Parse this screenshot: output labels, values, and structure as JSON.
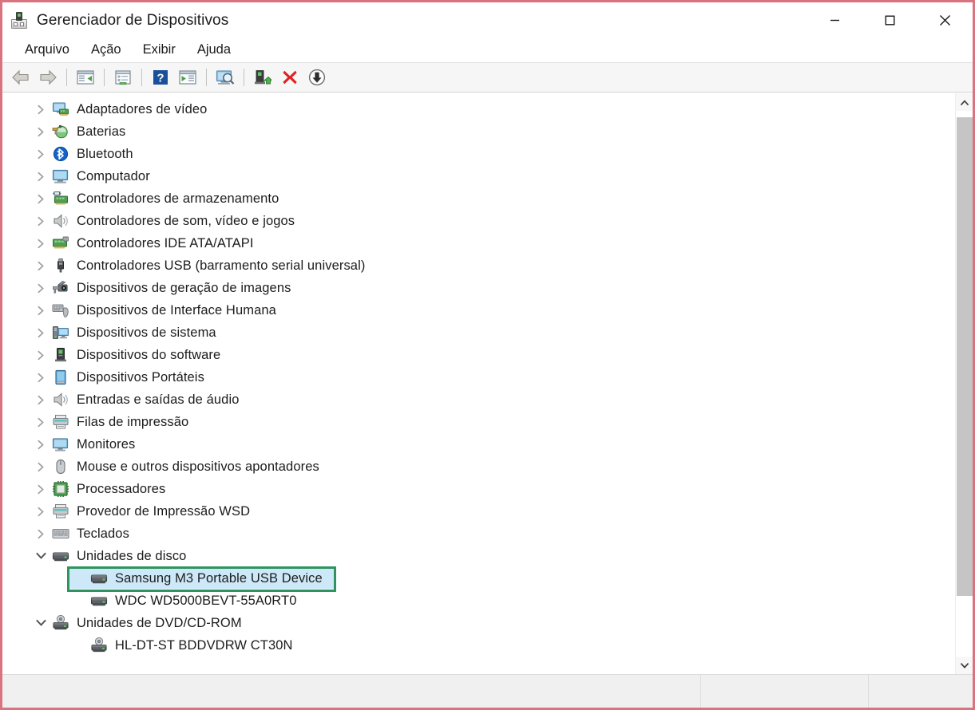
{
  "window": {
    "title": "Gerenciador de Dispositivos",
    "icon": "device-manager-icon",
    "controls": {
      "minimize": "minimize-icon",
      "maximize": "maximize-icon",
      "close": "close-icon"
    }
  },
  "annotation": {
    "frame_color": "#d9737f",
    "device_box_color": "#2f9460"
  },
  "menu": {
    "items": [
      {
        "label": "Arquivo",
        "name": "menu-arquivo"
      },
      {
        "label": "Ação",
        "name": "menu-acao"
      },
      {
        "label": "Exibir",
        "name": "menu-exibir"
      },
      {
        "label": "Ajuda",
        "name": "menu-ajuda"
      }
    ]
  },
  "toolbar": {
    "buttons": [
      {
        "icon": "back-arrow-icon",
        "tooltip": "Voltar"
      },
      {
        "icon": "forward-arrow-icon",
        "tooltip": "Avançar"
      },
      {
        "icon": "show-hide-console-tree-icon",
        "tooltip": "Mostrar/Ocultar árvore do console"
      },
      {
        "icon": "properties-icon",
        "tooltip": "Propriedades"
      },
      {
        "icon": "help-icon",
        "tooltip": "Ajuda"
      },
      {
        "icon": "show-hide-action-pane-icon",
        "tooltip": "Mostrar/Ocultar painel de ações"
      },
      {
        "icon": "scan-for-hardware-changes-icon",
        "tooltip": "Verificar se há alterações de hardware"
      },
      {
        "icon": "update-driver-icon",
        "tooltip": "Atualizar driver"
      },
      {
        "icon": "disable-device-icon",
        "tooltip": "Desabilitar dispositivo"
      },
      {
        "icon": "install-legacy-hardware-icon",
        "tooltip": "Instalar hardware"
      }
    ]
  },
  "tree": {
    "selection": {
      "bg_color": "#cde8f8"
    },
    "nodes": [
      {
        "label": "Adaptadores de vídeo",
        "icon": "display-adapter-icon",
        "depth": 1,
        "state": "collapsed",
        "selected": false
      },
      {
        "label": "Baterias",
        "icon": "battery-icon",
        "depth": 1,
        "state": "collapsed",
        "selected": false
      },
      {
        "label": "Bluetooth",
        "icon": "bluetooth-icon",
        "depth": 1,
        "state": "collapsed",
        "selected": false
      },
      {
        "label": "Computador",
        "icon": "computer-icon",
        "depth": 1,
        "state": "collapsed",
        "selected": false
      },
      {
        "label": "Controladores de armazenamento",
        "icon": "storage-controller-icon",
        "depth": 1,
        "state": "collapsed",
        "selected": false
      },
      {
        "label": "Controladores de som, vídeo e jogos",
        "icon": "sound-controller-icon",
        "depth": 1,
        "state": "collapsed",
        "selected": false
      },
      {
        "label": "Controladores IDE ATA/ATAPI",
        "icon": "ide-controller-icon",
        "depth": 1,
        "state": "collapsed",
        "selected": false
      },
      {
        "label": "Controladores USB (barramento serial universal)",
        "icon": "usb-controller-icon",
        "depth": 1,
        "state": "collapsed",
        "selected": false
      },
      {
        "label": "Dispositivos de geração de imagens",
        "icon": "imaging-device-icon",
        "depth": 1,
        "state": "collapsed",
        "selected": false
      },
      {
        "label": "Dispositivos de Interface Humana",
        "icon": "hid-device-icon",
        "depth": 1,
        "state": "collapsed",
        "selected": false
      },
      {
        "label": "Dispositivos de sistema",
        "icon": "system-device-icon",
        "depth": 1,
        "state": "collapsed",
        "selected": false
      },
      {
        "label": "Dispositivos do software",
        "icon": "software-device-icon",
        "depth": 1,
        "state": "collapsed",
        "selected": false
      },
      {
        "label": "Dispositivos Portáteis",
        "icon": "portable-device-icon",
        "depth": 1,
        "state": "collapsed",
        "selected": false
      },
      {
        "label": "Entradas e saídas de áudio",
        "icon": "audio-endpoint-icon",
        "depth": 1,
        "state": "collapsed",
        "selected": false
      },
      {
        "label": "Filas de impressão",
        "icon": "print-queue-icon",
        "depth": 1,
        "state": "collapsed",
        "selected": false
      },
      {
        "label": "Monitores",
        "icon": "monitor-icon",
        "depth": 1,
        "state": "collapsed",
        "selected": false
      },
      {
        "label": "Mouse e outros dispositivos apontadores",
        "icon": "mouse-icon",
        "depth": 1,
        "state": "collapsed",
        "selected": false
      },
      {
        "label": "Processadores",
        "icon": "processor-icon",
        "depth": 1,
        "state": "collapsed",
        "selected": false
      },
      {
        "label": "Provedor de Impressão WSD",
        "icon": "wsd-print-provider-icon",
        "depth": 1,
        "state": "collapsed",
        "selected": false
      },
      {
        "label": "Teclados",
        "icon": "keyboard-icon",
        "depth": 1,
        "state": "collapsed",
        "selected": false
      },
      {
        "label": "Unidades de disco",
        "icon": "disk-drive-icon",
        "depth": 1,
        "state": "expanded",
        "selected": false
      },
      {
        "label": "Samsung M3 Portable USB Device",
        "icon": "disk-drive-icon",
        "depth": 2,
        "state": "leaf",
        "selected": true
      },
      {
        "label": "WDC WD5000BEVT-55A0RT0",
        "icon": "disk-drive-icon",
        "depth": 2,
        "state": "leaf",
        "selected": false
      },
      {
        "label": "Unidades de DVD/CD-ROM",
        "icon": "dvd-drive-icon",
        "depth": 1,
        "state": "expanded",
        "selected": false
      },
      {
        "label": "HL-DT-ST BDDVDRW CT30N",
        "icon": "dvd-drive-icon",
        "depth": 2,
        "state": "leaf",
        "selected": false
      }
    ]
  },
  "scrollbar": {
    "up_arrow": "chevron-up-icon",
    "down_arrow": "chevron-down-icon",
    "thumb_position": "top"
  },
  "statusbar": {
    "main_text": "",
    "pane_a_text": "",
    "pane_b_text": ""
  }
}
